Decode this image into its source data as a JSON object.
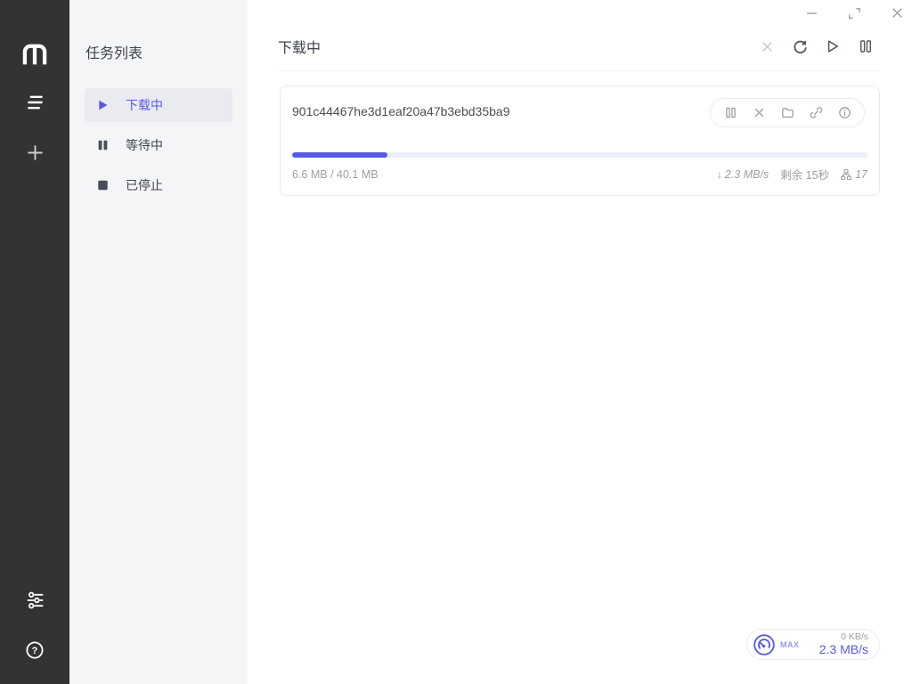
{
  "colors": {
    "accent": "#575ae2",
    "rail_bg": "#333333",
    "sidebar_bg": "#f4f5f7",
    "active_item_bg": "#e9ebf1",
    "progress_track": "#ebedf7",
    "card_border": "#e7e9ee",
    "muted_text": "#9b9ea4"
  },
  "icons": {
    "down_arrow": "↓",
    "help_glyph": "?"
  },
  "rail": {
    "items": [
      "motrix-logo",
      "task-list",
      "add-task",
      "preferences",
      "help"
    ]
  },
  "sidebar": {
    "title": "任务列表",
    "items": [
      {
        "label": "下载中",
        "icon": "play-icon",
        "active": true
      },
      {
        "label": "等待中",
        "icon": "pause-icon",
        "active": false
      },
      {
        "label": "已停止",
        "icon": "stop-icon",
        "active": false
      }
    ]
  },
  "header": {
    "title": "下载中",
    "actions": [
      "delete-selected",
      "refresh-list",
      "resume-all",
      "pause-all"
    ]
  },
  "task": {
    "name": "901c44467he3d1eaf20a47b3ebd35ba9",
    "progress_percent": 16.5,
    "size_text": "6.6 MB / 40.1 MB",
    "speed_text": "2.3 MB/s",
    "remaining_text": "剩余 15秒",
    "peers_count": "17",
    "actions": [
      "pause-task",
      "delete-task",
      "open-folder",
      "copy-link",
      "task-info"
    ]
  },
  "speed_widget": {
    "max_label": "MAX",
    "upload_speed": "0 KB/s",
    "download_speed": "2.3 MB/s"
  }
}
